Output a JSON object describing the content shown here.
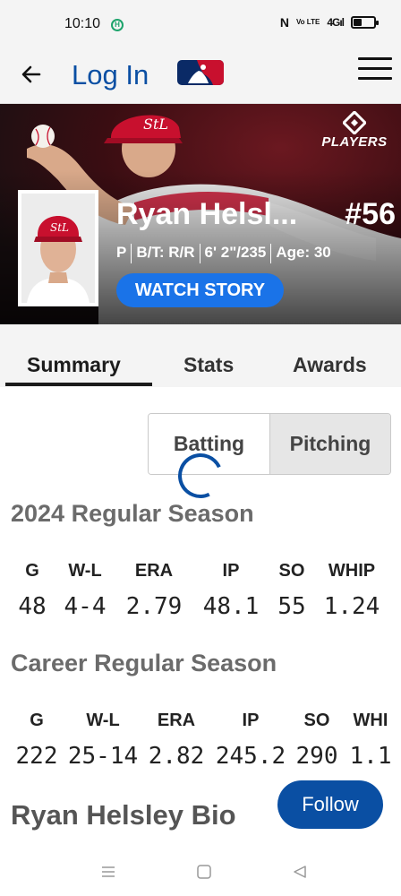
{
  "status_bar": {
    "time": "10:10",
    "app_badge": "H",
    "nfc": "N",
    "volte": "Vo LTE",
    "network": "4G",
    "battery_level": 0.4
  },
  "nav": {
    "title": "Log In",
    "logo": "mlb-logo"
  },
  "hero": {
    "players_logo": "PLAYERS",
    "name": "Ryan Helsl...",
    "number": "#56",
    "position": "P",
    "bats_throws": "B/T: R/R",
    "height_weight": "6' 2\"/235",
    "age": "Age: 30",
    "watch_label": "WATCH STORY",
    "colors": {
      "watch_button": "#1a73e8",
      "cap": "#c8102e"
    }
  },
  "tabs": [
    {
      "label": "Summary",
      "active": true
    },
    {
      "label": "Stats",
      "active": false
    },
    {
      "label": "Awards",
      "active": false
    }
  ],
  "stat_toggle": {
    "options": [
      "Batting",
      "Pitching"
    ],
    "selected": "Batting"
  },
  "season": {
    "title": "2024 Regular Season",
    "headers": [
      "G",
      "W-L",
      "ERA",
      "IP",
      "SO",
      "WHIP"
    ],
    "values": [
      "48",
      "4-4",
      "2.79",
      "48.1",
      "55",
      "1.24"
    ]
  },
  "career": {
    "title": "Career Regular Season",
    "headers": [
      "G",
      "W-L",
      "ERA",
      "IP",
      "SO",
      "WHI"
    ],
    "values": [
      "222",
      "25-14",
      "2.82",
      "245.2",
      "290",
      "1.1"
    ]
  },
  "bio": {
    "title": "Ryan Helsley Bio",
    "follow_label": "Follow"
  },
  "colors": {
    "brand_blue": "#0a4fa3",
    "section_grey": "#6b6b6b"
  }
}
